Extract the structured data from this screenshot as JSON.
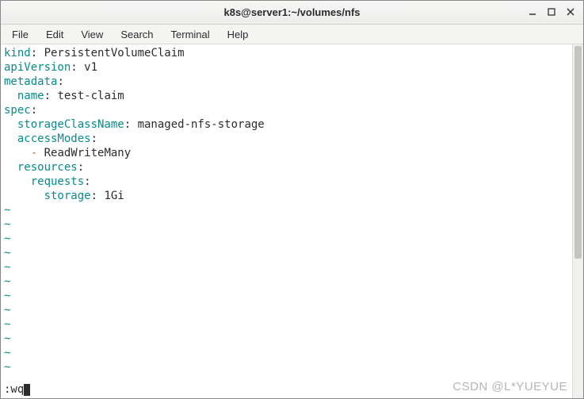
{
  "title": "k8s@server1:~/volumes/nfs",
  "menu": {
    "file": "File",
    "edit": "Edit",
    "view": "View",
    "search": "Search",
    "terminal": "Terminal",
    "help": "Help"
  },
  "yaml": {
    "l1k": "kind",
    "l1v": "PersistentVolumeClaim",
    "l2k": "apiVersion",
    "l2v": "v1",
    "l3k": "metadata",
    "l4k": "name",
    "l4v": "test-claim",
    "l5k": "spec",
    "l6k": "storageClassName",
    "l6v": "managed-nfs-storage",
    "l7k": "accessModes",
    "l8d": "-",
    "l8v": "ReadWriteMany",
    "l9k": "resources",
    "l10k": "requests",
    "l11k": "storage",
    "l11v": "1Gi"
  },
  "tilde": "~",
  "cmd": ":wq",
  "watermark": "CSDN @L*YUEYUE"
}
